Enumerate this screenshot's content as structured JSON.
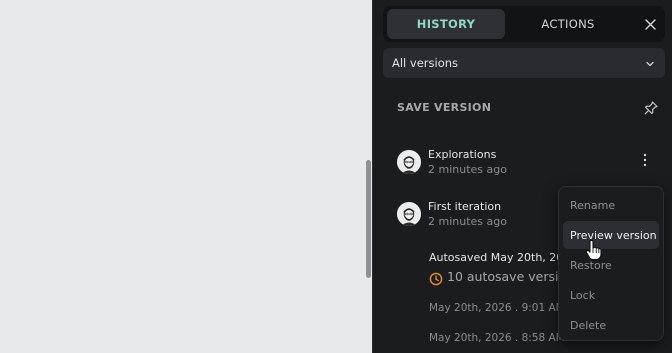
{
  "tabs": {
    "history": "HISTORY",
    "actions": "ACTIONS"
  },
  "filter": {
    "selected": "All versions"
  },
  "save_version_label": "SAVE VERSION",
  "versions": [
    {
      "title": "Explorations",
      "time": "2 minutes ago"
    },
    {
      "title": "First iteration",
      "time": "2 minutes ago"
    }
  ],
  "autosaved": {
    "title": "Autosaved May 20th, 2026",
    "count_label": "10 autosave versions",
    "dates": [
      "May 20th, 2026 . 9:01 AM",
      "May 20th, 2026 . 8:58 AM"
    ]
  },
  "context_menu": {
    "items": [
      "Rename",
      "Preview version",
      "Restore",
      "Lock",
      "Delete"
    ],
    "active_item": "Preview version"
  },
  "colors": {
    "panel_bg": "#1b1c1e",
    "accent_tab_text": "#8ed9c6",
    "autosave_clock": "#e8912d",
    "canvas_bg": "#e8e9ea"
  },
  "icons": [
    "close-icon",
    "chevron-down-icon",
    "pin-icon",
    "more-vertical-icon",
    "clock-icon",
    "hand-pointer-cursor"
  ]
}
